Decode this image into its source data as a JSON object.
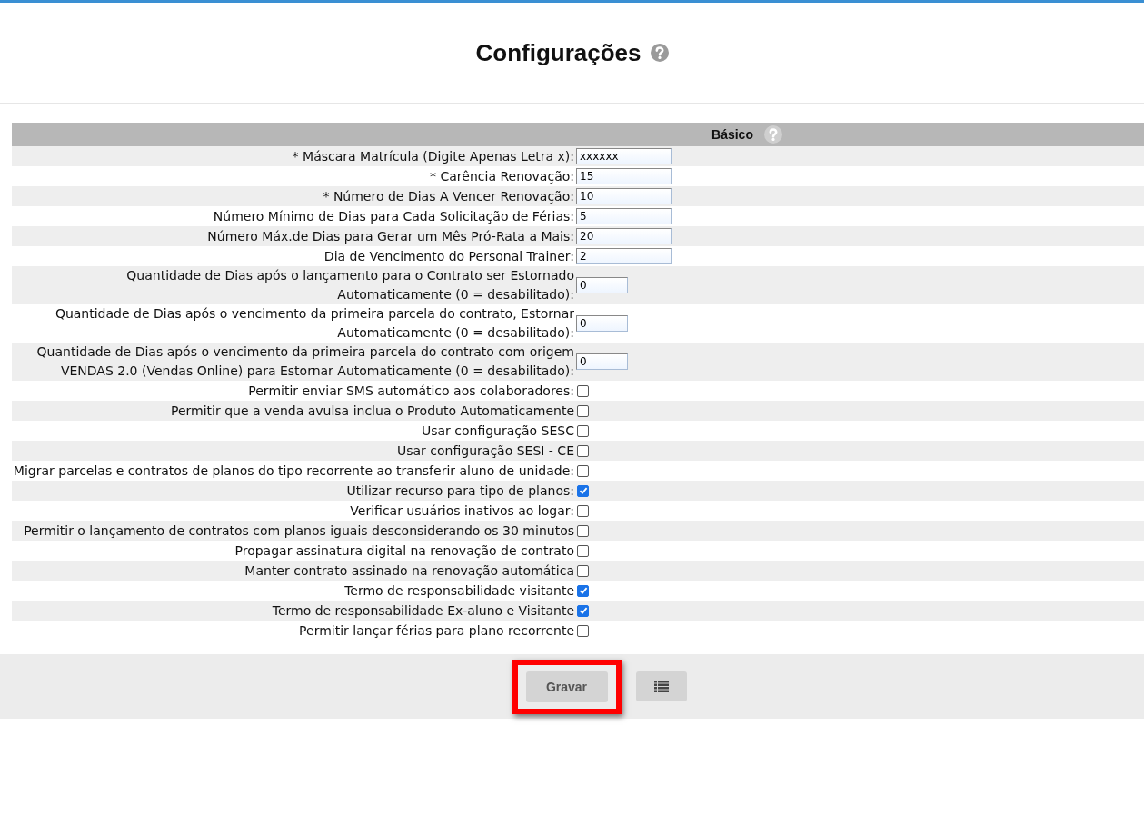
{
  "page": {
    "title": "Configurações"
  },
  "section": {
    "title": "Básico"
  },
  "rows": [
    {
      "kind": "field",
      "label": "* Máscara Matrícula (Digite Apenas Letra x):",
      "value": "xxxxxx"
    },
    {
      "kind": "field",
      "label": "* Carência Renovação:",
      "value": "15"
    },
    {
      "kind": "field",
      "label": "* Número de Dias A Vencer Renovação:",
      "value": "10"
    },
    {
      "kind": "field",
      "label": "Número Mínimo de Dias para Cada Solicitação de Férias:",
      "value": "5"
    },
    {
      "kind": "field",
      "label": "Número Máx.de Dias para Gerar um Mês Pró-Rata a Mais:",
      "value": "20"
    },
    {
      "kind": "field",
      "label": "Dia de Vencimento do Personal Trainer:",
      "value": "2"
    },
    {
      "kind": "short-field",
      "label": "Quantidade de Dias após o lançamento para o Contrato ser Estornado Automaticamente (0 = desabilitado):",
      "value": "0"
    },
    {
      "kind": "short-field",
      "label": "Quantidade de Dias após o vencimento da primeira parcela do contrato, Estornar Automaticamente (0 = desabilitado):",
      "value": "0"
    },
    {
      "kind": "short-field",
      "label": "Quantidade de Dias após o vencimento da primeira parcela do contrato com origem VENDAS 2.0 (Vendas Online) para Estornar Automaticamente (0 = desabilitado):",
      "value": "0"
    },
    {
      "kind": "checkbox",
      "label": "Permitir enviar SMS automático aos colaboradores:",
      "checked": false
    },
    {
      "kind": "checkbox",
      "label": "Permitir que a venda avulsa inclua o Produto Automaticamente",
      "checked": false
    },
    {
      "kind": "checkbox",
      "label": "Usar configuração SESC",
      "checked": false
    },
    {
      "kind": "checkbox",
      "label": "Usar configuração SESI - CE",
      "checked": false
    },
    {
      "kind": "checkbox",
      "label": "Migrar parcelas e contratos de planos do tipo recorrente ao transferir aluno de unidade:",
      "checked": false
    },
    {
      "kind": "checkbox",
      "label": "Utilizar recurso para tipo de planos:",
      "checked": true
    },
    {
      "kind": "checkbox",
      "label": "Verificar usuários inativos ao logar:",
      "checked": false
    },
    {
      "kind": "checkbox",
      "label": "Permitir o lançamento de contratos com planos iguais desconsiderando os 30 minutos",
      "checked": false
    },
    {
      "kind": "checkbox",
      "label": "Propagar assinatura digital na renovação de contrato",
      "checked": false
    },
    {
      "kind": "checkbox",
      "label": "Manter contrato assinado na renovação automática",
      "checked": false
    },
    {
      "kind": "checkbox",
      "label": "Termo de responsabilidade visitante",
      "checked": true
    },
    {
      "kind": "checkbox",
      "label": "Termo de responsabilidade Ex-aluno e Visitante",
      "checked": true
    },
    {
      "kind": "checkbox",
      "label": "Permitir lançar férias para plano recorrente",
      "checked": false
    }
  ],
  "footer": {
    "save_button": {
      "label": "Gravar",
      "highlighted": true
    }
  }
}
